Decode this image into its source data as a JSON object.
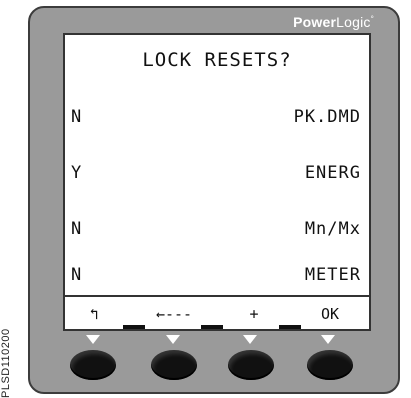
{
  "side_code": "PLSD110200",
  "brand": {
    "bold": "Power",
    "light": "Logic",
    "mark": "°"
  },
  "screen": {
    "title": "LOCK RESETS?",
    "rows": [
      {
        "value": "N",
        "label": "PK.DMD"
      },
      {
        "value": "Y",
        "label": "ENERG"
      },
      {
        "value": "N",
        "label": "Mn/Mx"
      },
      {
        "value": "N",
        "label": "METER"
      }
    ],
    "softkeys": [
      "↰",
      "←---",
      "+",
      "OK"
    ]
  }
}
